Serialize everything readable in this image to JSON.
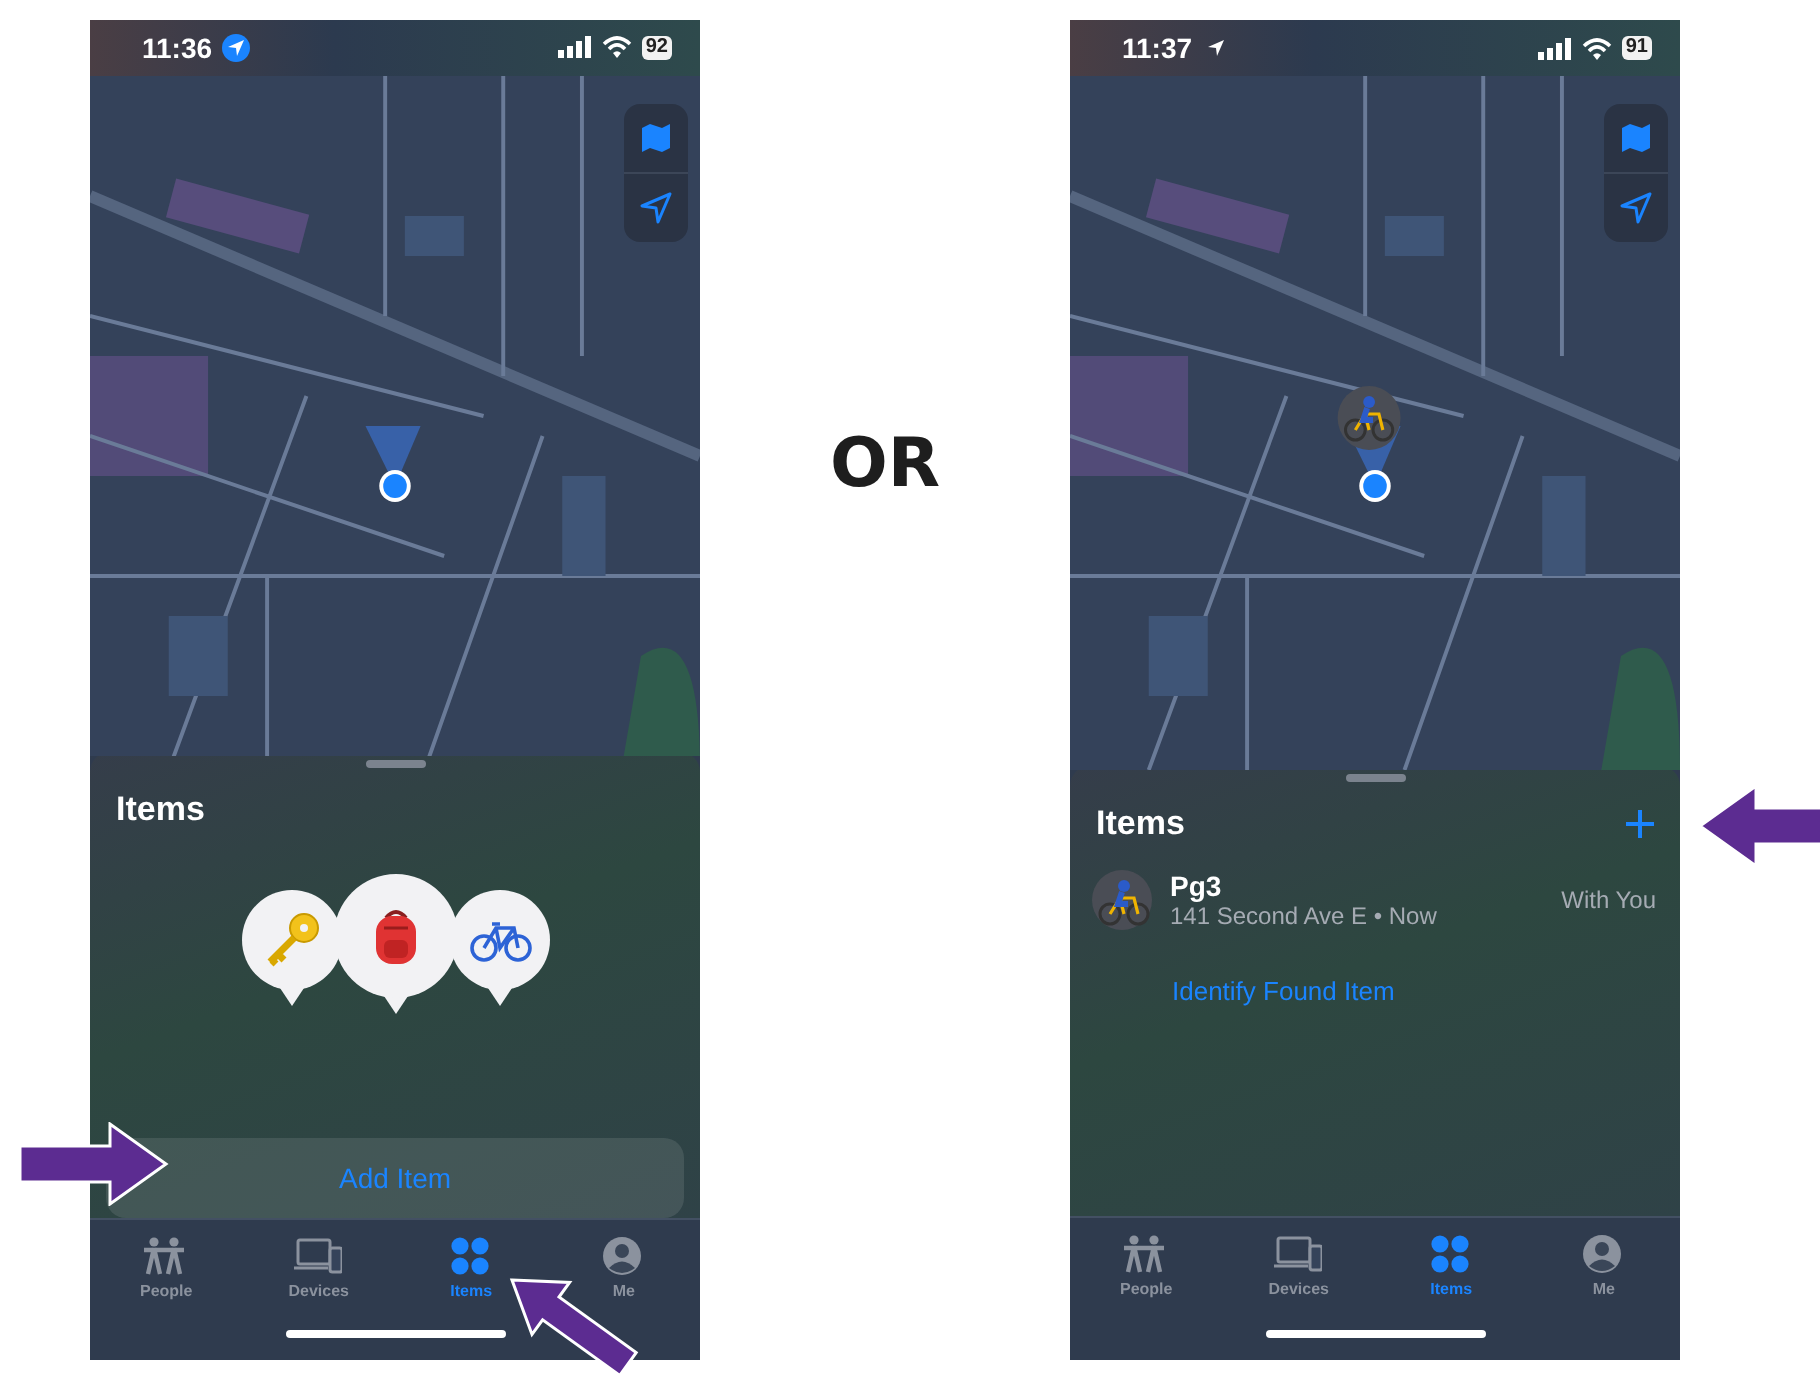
{
  "screens": [
    {
      "kind": "empty",
      "status_bar": {
        "time": "11:36",
        "location_active": true,
        "battery": "92"
      },
      "sheet": {
        "title": "Items",
        "action": "Add Item"
      },
      "tabs": [
        {
          "label": "People",
          "kind": "people",
          "selected": false
        },
        {
          "label": "Devices",
          "kind": "devices",
          "selected": false
        },
        {
          "label": "Items",
          "kind": "items",
          "selected": true
        },
        {
          "label": "Me",
          "kind": "me",
          "selected": false
        }
      ]
    },
    {
      "kind": "list",
      "status_bar": {
        "time": "11:37",
        "location_active": false,
        "battery": "91"
      },
      "sheet": {
        "title": "Items",
        "items": [
          {
            "name": "Pg3",
            "detail": "141 Second Ave E • Now",
            "status": "With You"
          }
        ],
        "link": "Identify Found Item"
      },
      "tabs": [
        {
          "label": "People",
          "kind": "people",
          "selected": false
        },
        {
          "label": "Devices",
          "kind": "devices",
          "selected": false
        },
        {
          "label": "Items",
          "kind": "items",
          "selected": true
        },
        {
          "label": "Me",
          "kind": "me",
          "selected": false
        }
      ]
    }
  ],
  "separator": "OR"
}
